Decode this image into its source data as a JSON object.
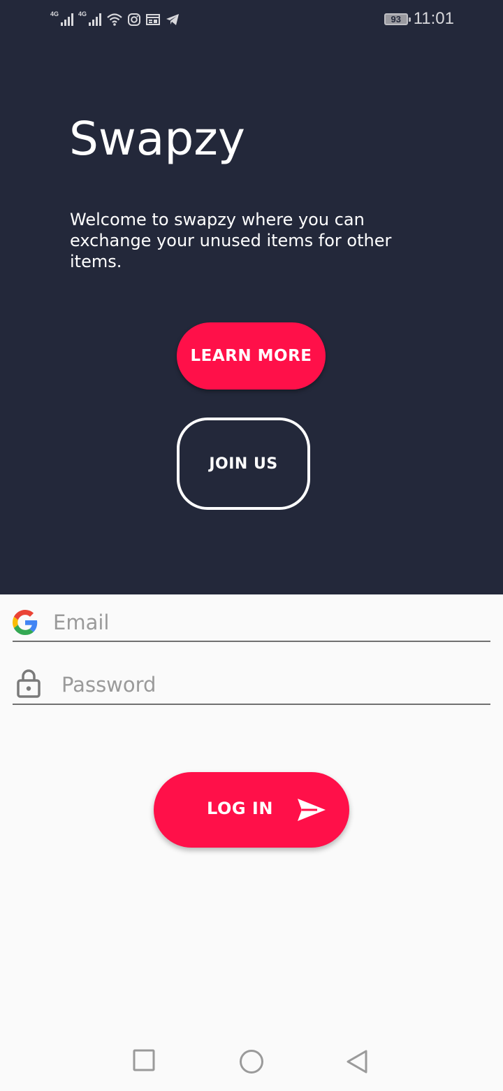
{
  "status_bar": {
    "network_1": "4G",
    "network_2": "4G",
    "battery": "93",
    "time": "11:01",
    "icons": [
      "signal-icon",
      "signal-icon",
      "wifi-icon",
      "instagram-icon",
      "news-icon",
      "telegram-icon"
    ]
  },
  "hero": {
    "app_title": "Swapzy",
    "welcome_text": "Welcome to swapzy where you can exchange your unused items for other items.",
    "learn_more_label": "LEARN MORE",
    "join_us_label": "JOIN US"
  },
  "login": {
    "email_placeholder": "Email",
    "password_placeholder": "Password",
    "login_label": "LOG IN"
  },
  "nav_bar": {
    "buttons": [
      "recents-square-icon",
      "home-circle-icon",
      "back-triangle-icon"
    ]
  },
  "colors": {
    "hero_background": "#23283a",
    "accent": "#ff1049",
    "page_background": "#fafafa"
  }
}
